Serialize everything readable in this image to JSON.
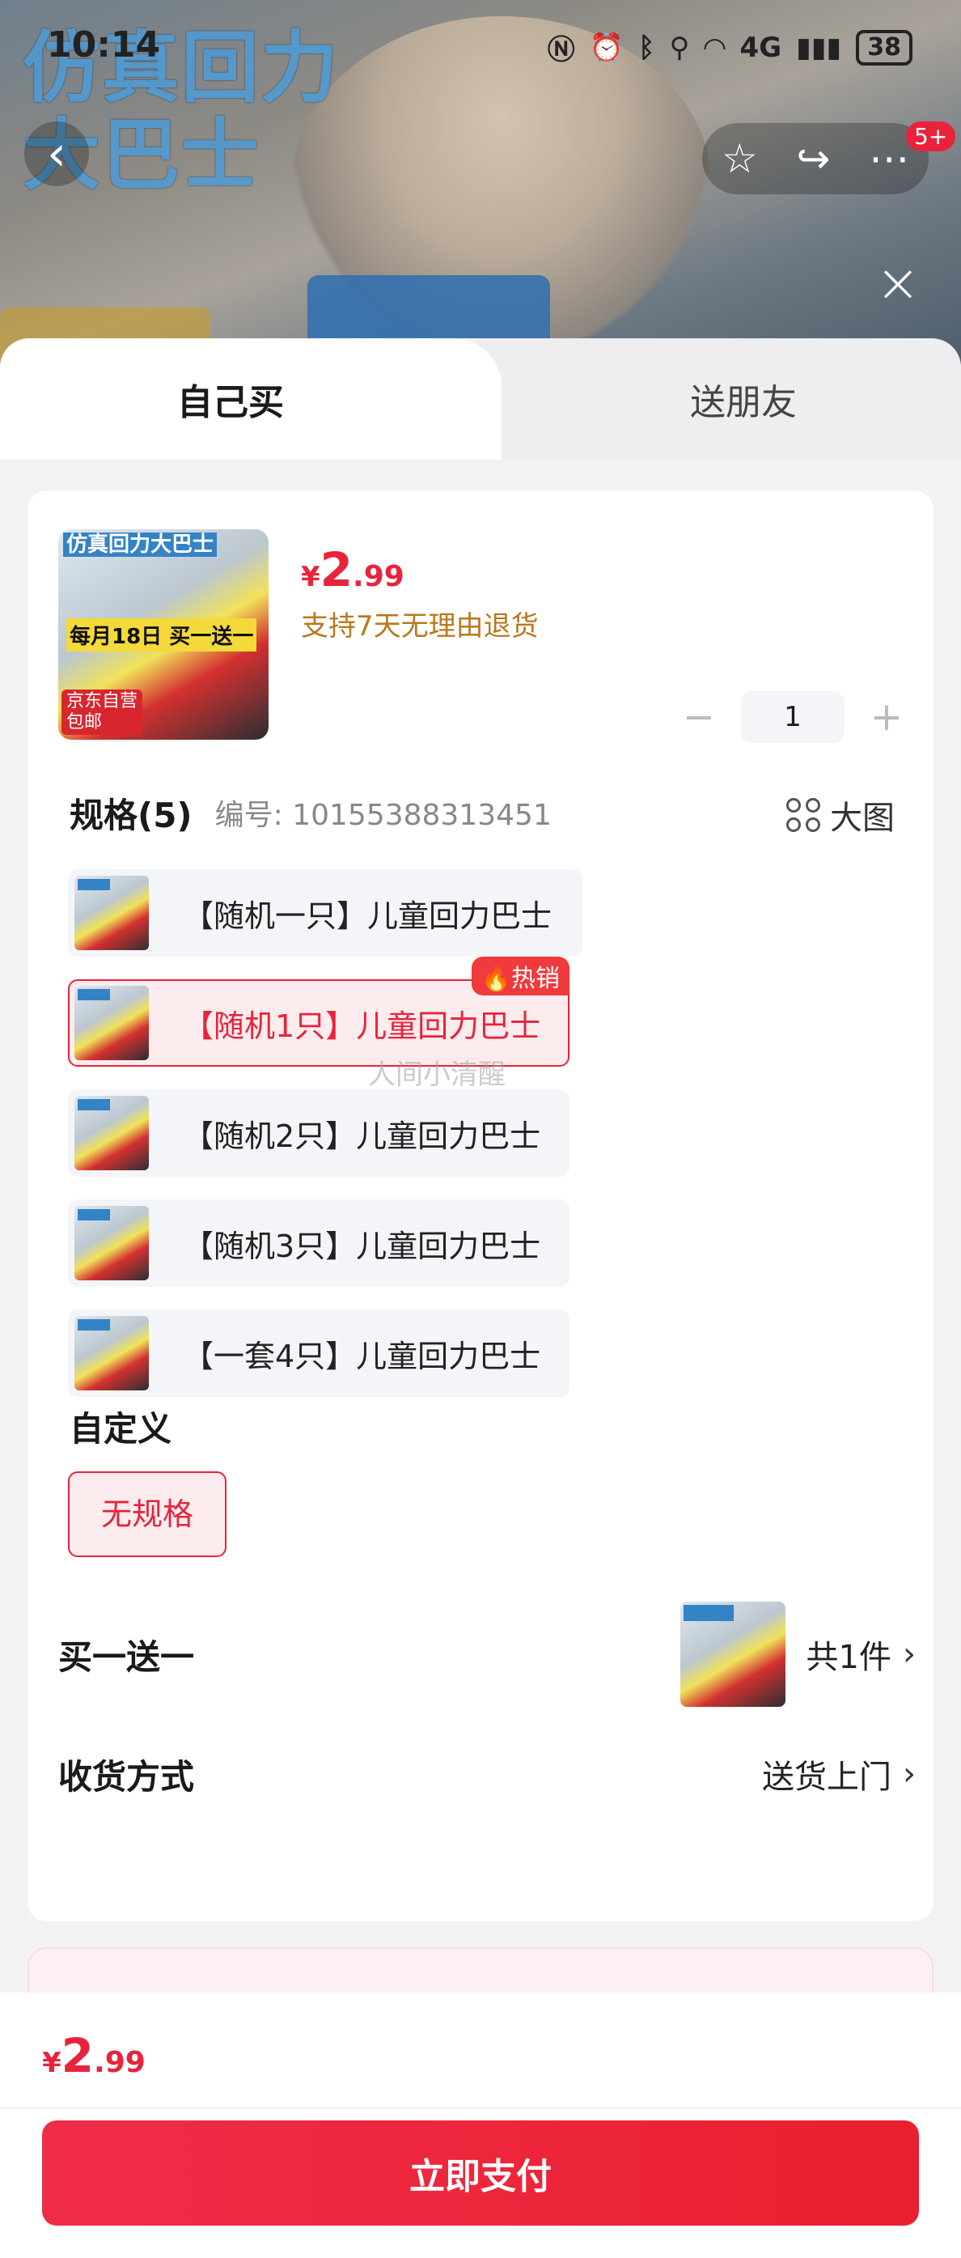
{
  "status_bar": {
    "time": "10:14",
    "network": "4G",
    "battery": "38"
  },
  "hero": {
    "promo_title_line1": "仿真回力",
    "promo_title_line2": "大巴士",
    "notification_count": "5+"
  },
  "tabs": {
    "self": "自己买",
    "friend": "送朋友"
  },
  "product": {
    "thumb_title": "仿真回力大巴士",
    "thumb_promo": "每月18日 买一送一",
    "thumb_badge_line1": "京东自营",
    "thumb_badge_line2": "包邮",
    "price_currency": "¥",
    "price_integer": "2",
    "price_decimal": ".99",
    "return_policy": "支持7天无理由退货",
    "quantity": "1",
    "minus": "−",
    "plus": "+"
  },
  "spec": {
    "title": "规格(5)",
    "code_label": "编号: 10155388313451",
    "big_image_label": "大图",
    "hot_badge": "热销",
    "options": [
      {
        "label": "【随机一只】儿童回力巴士",
        "selected": false
      },
      {
        "label": "【随机1只】儿童回力巴士",
        "selected": true
      },
      {
        "label": "【随机2只】儿童回力巴士",
        "selected": false
      },
      {
        "label": "【随机3只】儿童回力巴士",
        "selected": false
      },
      {
        "label": "【一套4只】儿童回力巴士",
        "selected": false
      }
    ]
  },
  "custom": {
    "title": "自定义",
    "option": "无规格"
  },
  "gift_row": {
    "label": "买一送一",
    "value": "共1件"
  },
  "delivery_row": {
    "label": "收货方式",
    "value": "送货上门"
  },
  "footer": {
    "price_currency": "¥",
    "price_integer": "2",
    "price_decimal": ".99",
    "pay_button": "立即支付"
  },
  "watermark": "人间小清醒",
  "colors": {
    "accent": "#e8233b",
    "policy": "#b9781f",
    "sheet_bg": "#f2f2f4"
  }
}
